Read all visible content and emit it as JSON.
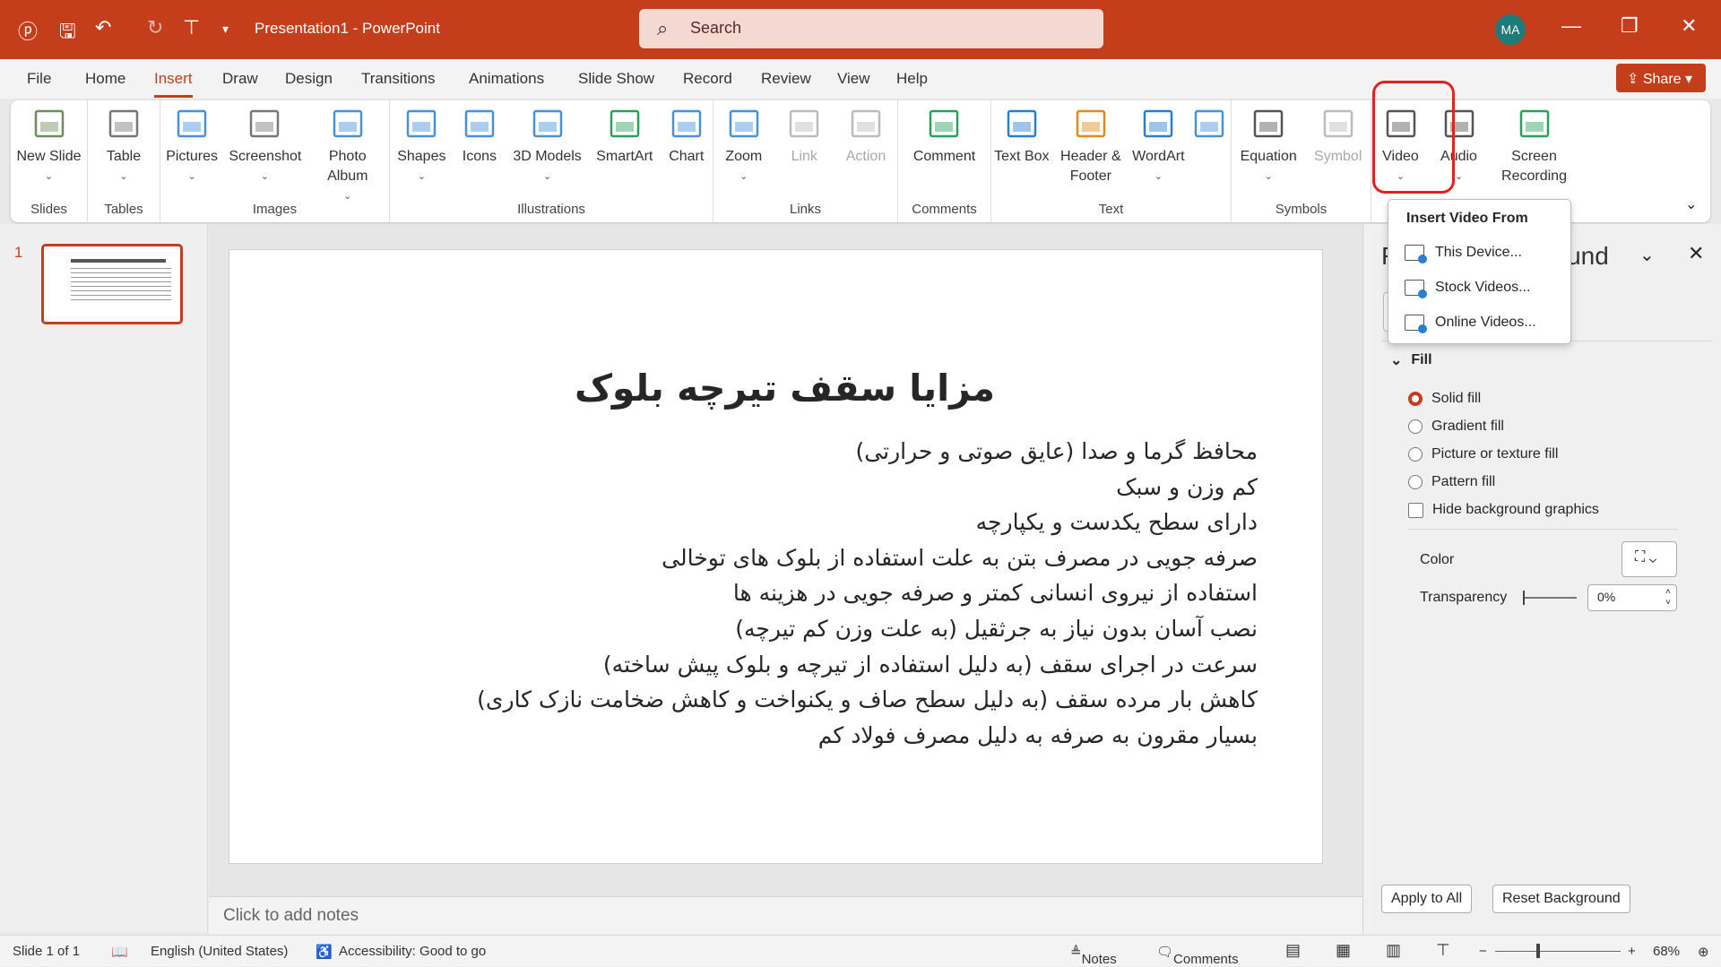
{
  "titlebar": {
    "doc_title": "Presentation1  -  PowerPoint",
    "search_placeholder": "Search",
    "avatar": "MA",
    "accent": "#c43e1c"
  },
  "menu": {
    "tabs": [
      "File",
      "Home",
      "Insert",
      "Draw",
      "Design",
      "Transitions",
      "Animations",
      "Slide Show",
      "Record",
      "Review",
      "View",
      "Help"
    ],
    "active": "Insert",
    "share": "Share"
  },
  "ribbon": {
    "groups": [
      {
        "label": "Slides",
        "items": [
          {
            "label": "New Slide",
            "icon": "new-slide-icon",
            "dropdown": true
          }
        ]
      },
      {
        "label": "Tables",
        "items": [
          {
            "label": "Table",
            "icon": "table-icon",
            "dropdown": true
          }
        ]
      },
      {
        "label": "Images",
        "items": [
          {
            "label": "Pictures",
            "icon": "pictures-icon",
            "dropdown": true
          },
          {
            "label": "Screenshot",
            "icon": "screenshot-icon",
            "dropdown": true
          },
          {
            "label": "Photo Album",
            "icon": "photo-album-icon",
            "dropdown": true
          }
        ]
      },
      {
        "label": "Illustrations",
        "items": [
          {
            "label": "Shapes",
            "icon": "shapes-icon",
            "dropdown": true
          },
          {
            "label": "Icons",
            "icon": "icons-icon"
          },
          {
            "label": "3D Models",
            "icon": "3d-models-icon",
            "dropdown": true
          },
          {
            "label": "SmartArt",
            "icon": "smartart-icon"
          },
          {
            "label": "Chart",
            "icon": "chart-icon"
          }
        ]
      },
      {
        "label": "Links",
        "items": [
          {
            "label": "Zoom",
            "icon": "zoom-icon",
            "dropdown": true
          },
          {
            "label": "Link",
            "icon": "link-icon",
            "disabled": true
          },
          {
            "label": "Action",
            "icon": "action-icon",
            "disabled": true
          }
        ]
      },
      {
        "label": "Comments",
        "items": [
          {
            "label": "Comment",
            "icon": "comment-icon"
          }
        ]
      },
      {
        "label": "Text",
        "items": [
          {
            "label": "Text Box",
            "icon": "text-box-icon"
          },
          {
            "label": "Header & Footer",
            "icon": "header-footer-icon"
          },
          {
            "label": "WordArt",
            "icon": "wordart-icon",
            "dropdown": true
          },
          {
            "label": "",
            "icon": "date-time-icon"
          }
        ]
      },
      {
        "label": "Symbols",
        "items": [
          {
            "label": "Equation",
            "icon": "equation-icon",
            "dropdown": true
          },
          {
            "label": "Symbol",
            "icon": "symbol-icon",
            "disabled": true
          }
        ]
      },
      {
        "label": "",
        "items": [
          {
            "label": "Video",
            "icon": "video-icon",
            "dropdown": true
          },
          {
            "label": "Audio",
            "icon": "audio-icon",
            "dropdown": true
          },
          {
            "label": "Screen Recording",
            "icon": "screen-recording-icon"
          }
        ]
      }
    ]
  },
  "video_menu": {
    "header": "Insert Video From",
    "items": [
      "This Device...",
      "Stock Videos...",
      "Online Videos..."
    ]
  },
  "thumbnails": {
    "number": "1"
  },
  "slide": {
    "title": "مزایا سقف تیرچه بلوک",
    "bullets": [
      "محافظ گرما و صدا (عایق صوتی و حرارتی)",
      "کم وزن و سبک",
      "دارای سطح یکدست و یکپارچه",
      "صرفه جویی در مصرف بتن به علت استفاده از بلوک های توخالی",
      "استفاده از نیروی انسانی کمتر و صرفه جویی در هزینه ها",
      "نصب آسان بدون نیاز به جرثقیل (به علت وزن کم تیرچه)",
      "سرعت در اجرای سقف (به دلیل استفاده از تیرچه و بلوک پیش ساخته)",
      "کاهش بار مرده سقف (به دلیل سطح صاف و یکنواخت و کاهش ضخامت نازک کاری)",
      "بسیار مقرون به صرفه به دلیل مصرف فولاد کم"
    ]
  },
  "notes": {
    "placeholder": "Click to add notes"
  },
  "pane": {
    "title_left": "F",
    "title_right": "und",
    "fill_header": "Fill",
    "options": [
      "Solid fill",
      "Gradient fill",
      "Picture or texture fill",
      "Pattern fill"
    ],
    "selected": "Solid fill",
    "hide_bg": "Hide background graphics",
    "hide_bg_checked": false,
    "color_label": "Color",
    "transparency_label": "Transparency",
    "transparency_value": "0%",
    "apply_all": "Apply to All",
    "reset": "Reset Background"
  },
  "status": {
    "slide": "Slide 1 of 1",
    "language": "English (United States)",
    "accessibility": "Accessibility: Good to go",
    "notes": "Notes",
    "comments": "Comments",
    "zoom": "68%"
  }
}
